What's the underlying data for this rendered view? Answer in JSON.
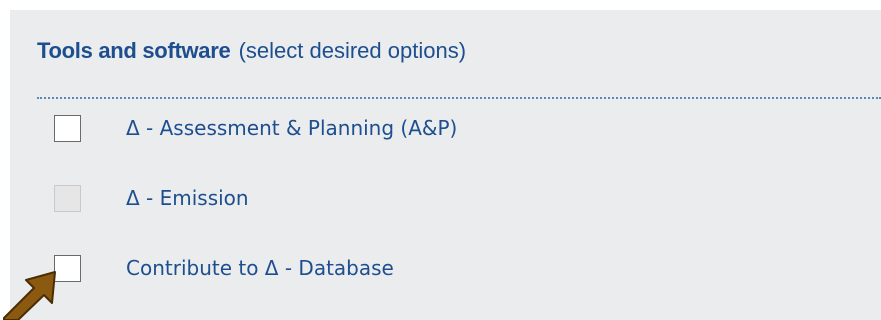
{
  "section": {
    "title_strong": "Tools and software",
    "title_hint": "(select desired options)"
  },
  "options": [
    {
      "label": "Δ - Assessment & Planning (A&P)",
      "checked": false,
      "disabled": false
    },
    {
      "label": "Δ - Emission",
      "checked": false,
      "disabled": true
    },
    {
      "label": "Contribute to Δ - Database",
      "checked": false,
      "disabled": false
    }
  ],
  "colors": {
    "panel_background": "#ebecee",
    "text_blue": "#1d4f8f",
    "divider": "#5a86b8",
    "pointer_fill": "#8b5a10",
    "pointer_outline": "#4a2d05"
  },
  "pointer": {
    "icon": "arrow-pointer-icon",
    "target": "Contribute to Δ - Database checkbox"
  }
}
